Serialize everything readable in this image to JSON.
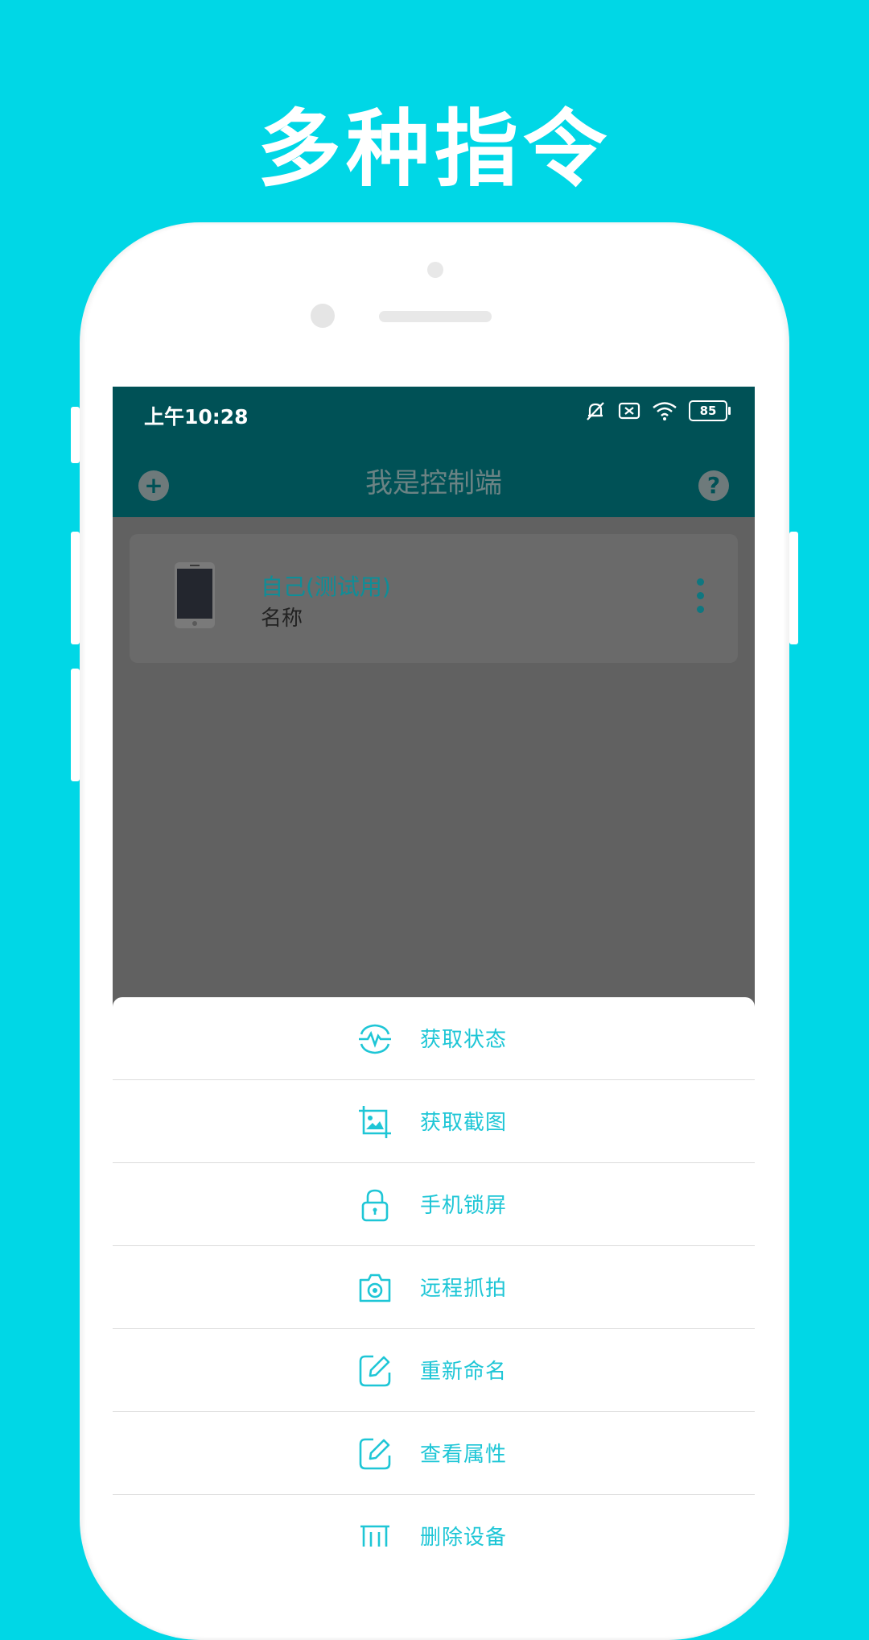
{
  "promo": {
    "headline": "多种指令"
  },
  "status_bar": {
    "time": "上午10:28",
    "battery": "85"
  },
  "app_bar": {
    "title": "我是控制端",
    "add_icon": "plus-circle-icon",
    "help_icon": "help-circle-icon"
  },
  "device": {
    "name": "自己(测试用)",
    "subtitle": "名称",
    "icon": "phone-device-icon"
  },
  "menu": {
    "items": [
      {
        "label": "获取状态",
        "icon": "heartbeat-icon"
      },
      {
        "label": "获取截图",
        "icon": "crop-image-icon"
      },
      {
        "label": "手机锁屏",
        "icon": "lock-icon"
      },
      {
        "label": "远程抓拍",
        "icon": "camera-icon"
      },
      {
        "label": "重新命名",
        "icon": "edit-icon"
      },
      {
        "label": "查看属性",
        "icon": "edit-icon"
      },
      {
        "label": "删除设备",
        "icon": "trash-icon"
      }
    ]
  },
  "colors": {
    "background": "#00d7e6",
    "primary_dark": "#005156",
    "accent": "#1ec6d6"
  }
}
